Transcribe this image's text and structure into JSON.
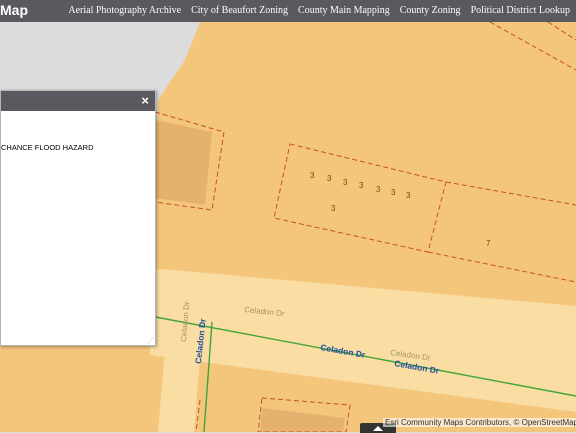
{
  "app": {
    "title_fragment": "Map"
  },
  "nav": {
    "items": [
      "Aerial Photography Archive",
      "City of Beaufort Zoning",
      "County Main Mapping",
      "County Zoning",
      "Political District Lookup"
    ]
  },
  "popup": {
    "close_glyph": "×",
    "text": "CHANCE FLOOD HAZARD",
    "resize_glyph": "⋰"
  },
  "map": {
    "street_labels": [
      "Celadon Dr",
      "Celadon Dr",
      "Celadon Dr",
      "Celadon Dr",
      "Celadon Dr",
      "Celadon Dr"
    ],
    "parcel_labels": [
      "3",
      "3",
      "3",
      "3",
      "3",
      "3",
      "3",
      "3",
      "7"
    ],
    "colors": {
      "flood_zone": "#f4c67c",
      "road": "#fadda3",
      "building": "#e0ad6c",
      "parcel_line": "#c8502a",
      "centerline": "#3fa53a",
      "street_blue": "#1f4fa0",
      "street_beige": "#a89468"
    }
  },
  "attribution": {
    "text": "Esri Community Maps Contributors, © OpenStreetMap"
  }
}
